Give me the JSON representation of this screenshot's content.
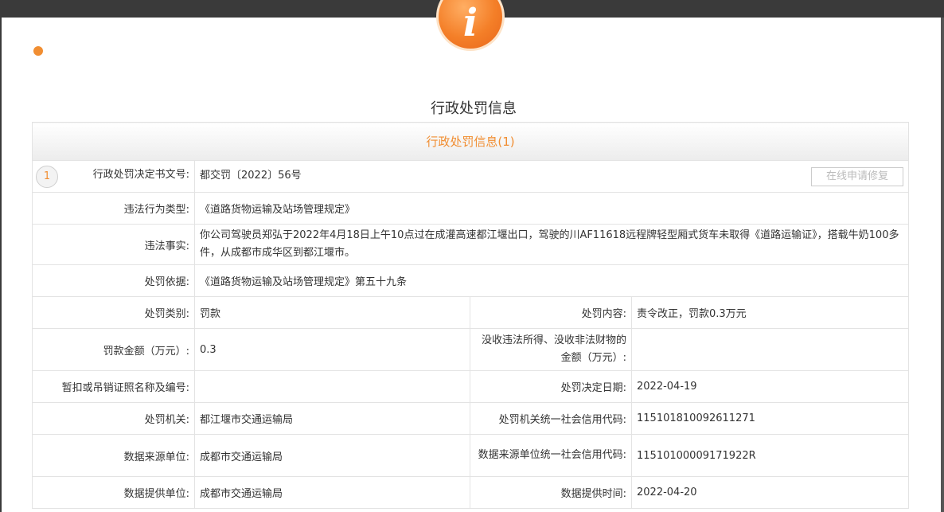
{
  "page": {
    "title": "行政处罚信息",
    "section_title": "行政处罚信息(1)"
  },
  "colors": {
    "accent": "#f18e32",
    "border": "#e3e3e3"
  },
  "icons": {
    "badge": "info-icon",
    "dot": "status-dot"
  },
  "badge_letter": "i",
  "record": {
    "index": "1",
    "repair_button": "在线申请修复",
    "rows": [
      {
        "label": "行政处罚决定书文号:",
        "value": "都交罚〔2022〕56号"
      },
      {
        "label": "违法行为类型:",
        "value": "《道路货物运输及站场管理规定》"
      },
      {
        "label": "违法事实:",
        "value": "你公司驾驶员郑弘于2022年4月18日上午10点过在成灌高速都江堰出口，驾驶的川AF11618远程牌轻型厢式货车未取得《道路运输证》，搭载牛奶100多件，从成都市成华区到都江堰市。"
      },
      {
        "label": "处罚依据:",
        "value": "《道路货物运输及站场管理规定》第五十九条"
      }
    ],
    "pairs": [
      {
        "label1": "处罚类别:",
        "value1": "罚款",
        "label2": "处罚内容:",
        "value2": "责令改正，罚款0.3万元"
      },
      {
        "label1": "罚款金额（万元）:",
        "value1": "0.3",
        "label2": "没收违法所得、没收非法财物的金额（万元）:",
        "value2": ""
      },
      {
        "label1": "暂扣或吊销证照名称及编号:",
        "value1": "",
        "label2": "处罚决定日期:",
        "value2": "2022-04-19"
      },
      {
        "label1": "处罚机关:",
        "value1": "都江堰市交通运输局",
        "label2": "处罚机关统一社会信用代码:",
        "value2": "115101810092611271"
      },
      {
        "label1": "数据来源单位:",
        "value1": "成都市交通运输局",
        "label2": "数据来源单位统一社会信用代码:",
        "value2": "11510100009171922R"
      },
      {
        "label1": "数据提供单位:",
        "value1": "成都市交通运输局",
        "label2": "数据提供时间:",
        "value2": "2022-04-20"
      }
    ]
  }
}
